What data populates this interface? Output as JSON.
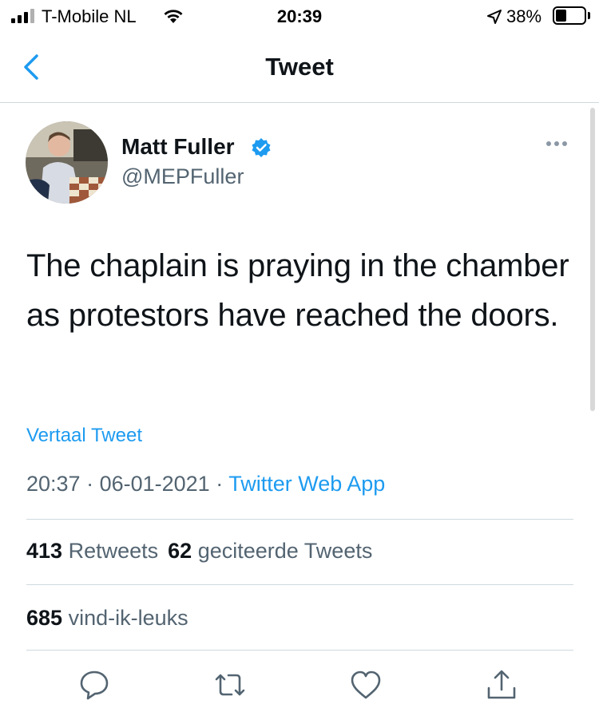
{
  "status_bar": {
    "carrier": "T-Mobile NL",
    "time": "20:39",
    "battery_percent_label": "38%",
    "battery_level": 0.38
  },
  "header": {
    "title": "Tweet",
    "back_icon": "chevron-left-icon"
  },
  "tweet": {
    "author_name": "Matt Fuller",
    "author_handle": "@MEPFuller",
    "verified_icon": "verified-badge-icon",
    "text": "The chaplain is praying in the chamber as protestors have reached the doors.",
    "translate_label": "Vertaal Tweet",
    "time": "20:37",
    "separator": " · ",
    "date": "06-01-2021",
    "source": "Twitter Web App"
  },
  "stats": {
    "retweets_count": "413",
    "retweets_label": "Retweets",
    "quotes_count": "62",
    "quotes_label": "geciteerde Tweets",
    "likes_count": "685",
    "likes_label": "vind-ik-leuks"
  },
  "actions": [
    "reply-icon",
    "retweet-icon",
    "like-icon",
    "share-icon"
  ],
  "colors": {
    "accent": "#1d9bf0",
    "text": "#0f1419",
    "secondary": "#536471",
    "divider": "#cfd9de"
  }
}
